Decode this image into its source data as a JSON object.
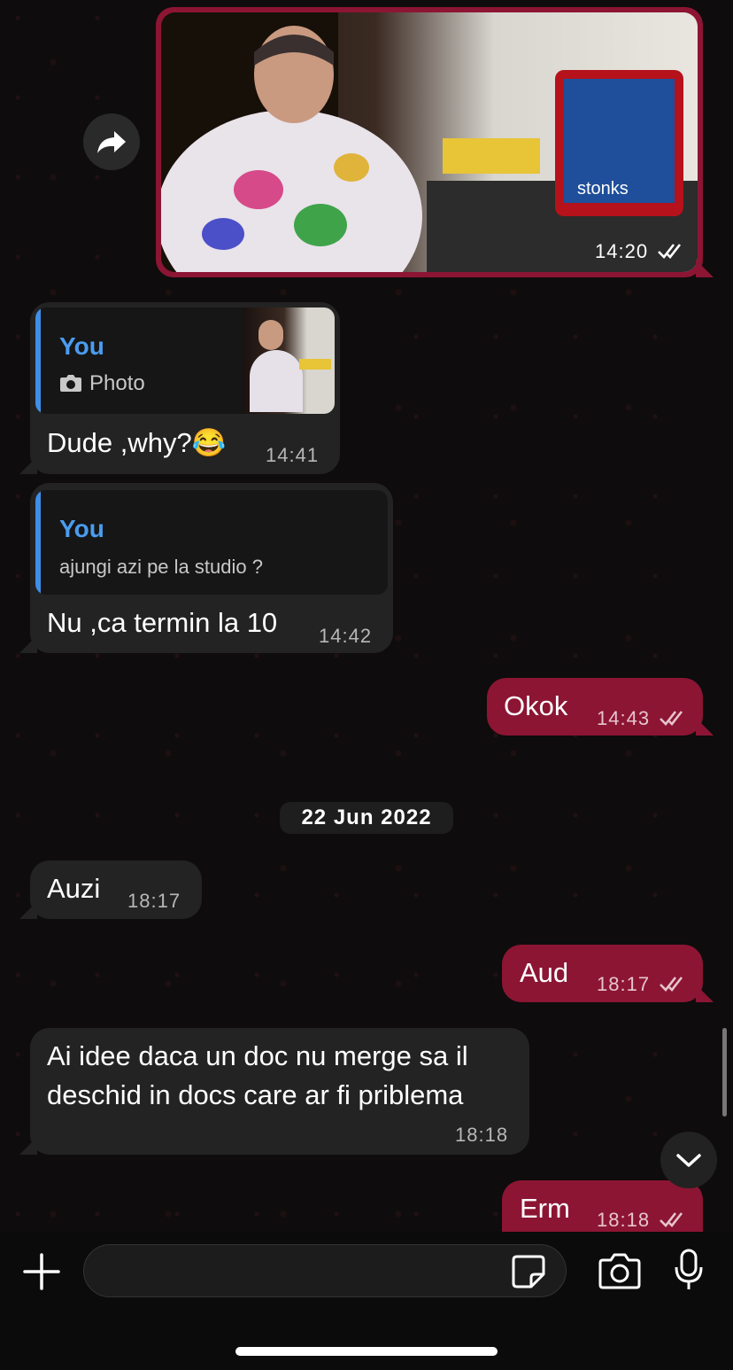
{
  "messages": {
    "photo_message": {
      "time": "14:20",
      "image_caption": "stonks"
    },
    "reply1": {
      "reply_name": "You",
      "reply_sub": "Photo",
      "text": "Dude ,why?😂",
      "time": "14:41"
    },
    "reply2": {
      "reply_name": "You",
      "reply_sub": "ajungi azi pe la studio ?",
      "text": "Nu ,ca termin la 10",
      "time": "14:42"
    },
    "out1": {
      "text": "Okok",
      "time": "14:43"
    },
    "date_separator": "22 Jun 2022",
    "in1": {
      "text": "Auzi",
      "time": "18:17"
    },
    "out2": {
      "text": "Aud",
      "time": "18:17"
    },
    "in2": {
      "line1": "Ai idee daca un doc nu merge sa il",
      "line2": "deschid in docs care ar fi priblema",
      "time": "18:18"
    },
    "out3": {
      "text": "Erm",
      "time": "18:18"
    }
  },
  "icons": {
    "forward": "forward-icon",
    "camera_small": "camera-icon",
    "scroll_down": "chevron-down-icon",
    "plus": "plus-icon",
    "sticker": "sticker-icon",
    "camera": "camera-icon",
    "mic": "microphone-icon"
  },
  "colors": {
    "outgoing": "#8c1534",
    "incoming": "#232323",
    "reply_accent": "#4a9cf0"
  }
}
